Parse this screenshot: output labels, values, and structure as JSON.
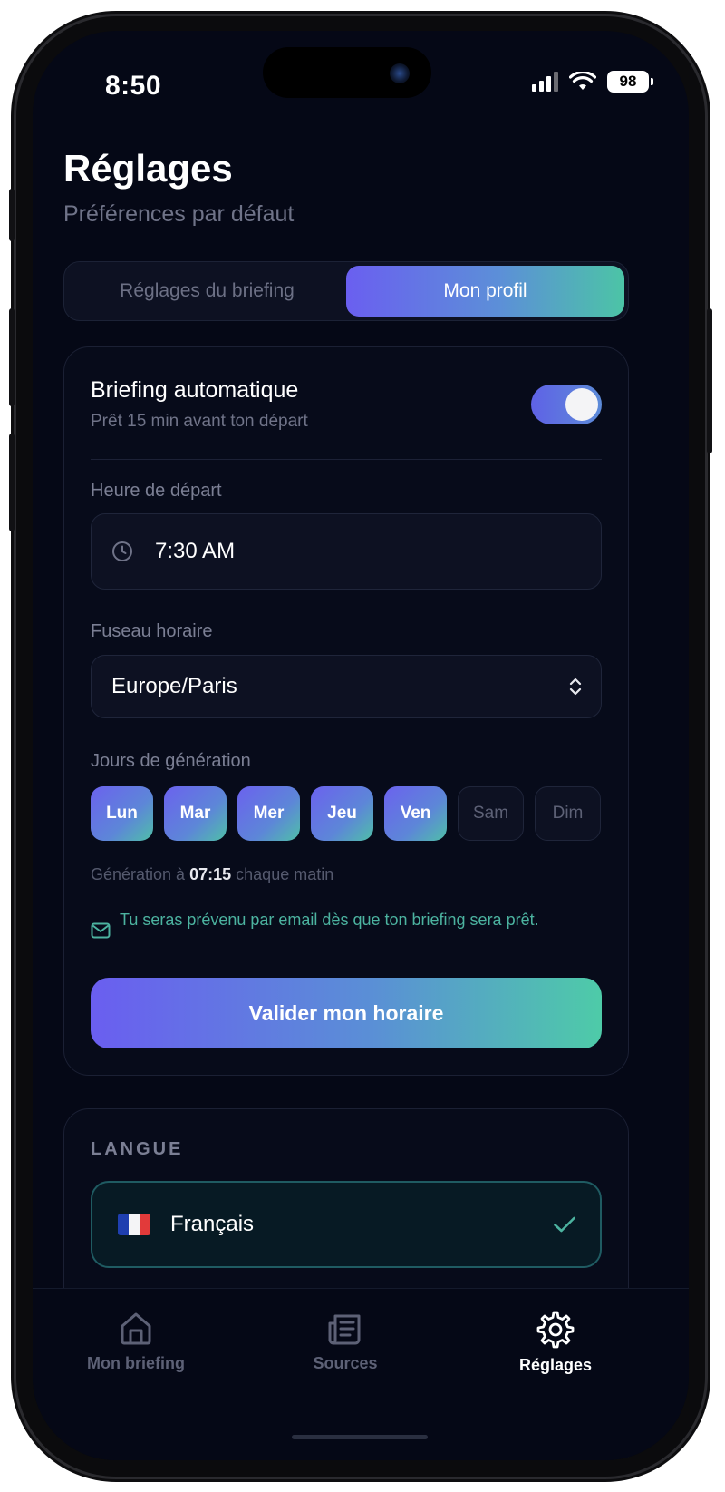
{
  "status_bar": {
    "time": "8:50",
    "battery": "98"
  },
  "header": {
    "title": "Réglages",
    "subtitle": "Préférences par défaut"
  },
  "segmented": {
    "tab1": "Réglages du briefing",
    "tab2": "Mon profil",
    "active": "Mon profil"
  },
  "briefing": {
    "auto_title": "Briefing automatique",
    "auto_subtitle": "Prêt 15 min avant ton départ",
    "auto_enabled": true,
    "departure_label": "Heure de départ",
    "departure_time": "7:30 AM",
    "timezone_label": "Fuseau horaire",
    "timezone": "Europe/Paris",
    "days_label": "Jours de génération",
    "days": [
      {
        "label": "Lun",
        "selected": true
      },
      {
        "label": "Mar",
        "selected": true
      },
      {
        "label": "Mer",
        "selected": true
      },
      {
        "label": "Jeu",
        "selected": true
      },
      {
        "label": "Ven",
        "selected": true
      },
      {
        "label": "Sam",
        "selected": false
      },
      {
        "label": "Dim",
        "selected": false
      }
    ],
    "generation_prefix": "Génération à",
    "generation_time": "07:15",
    "generation_suffix": "chaque matin",
    "email_note": "Tu seras prévenu par email dès que ton briefing sera prêt.",
    "validate_label": "Valider mon horaire"
  },
  "language": {
    "heading": "LANGUE",
    "selected": "Français"
  },
  "tabbar": {
    "items": [
      {
        "label": "Mon briefing",
        "icon": "home-icon"
      },
      {
        "label": "Sources",
        "icon": "newspaper-icon"
      },
      {
        "label": "Réglages",
        "icon": "gear-icon"
      }
    ],
    "active": "Réglages"
  },
  "colors": {
    "background": "#050816",
    "accent_start": "#6a5ef0",
    "accent_end": "#4ecba8",
    "teal": "#4cb3a0"
  }
}
